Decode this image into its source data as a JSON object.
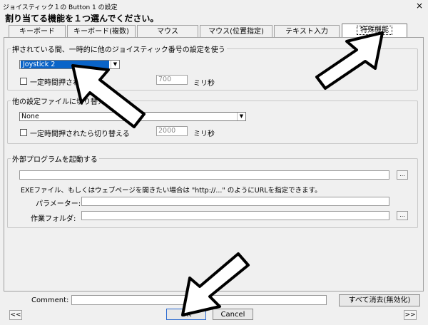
{
  "window": {
    "title": "ジョイスティック１の Button 1 の設定",
    "close": "×"
  },
  "heading": "割り当てる機能を１つ選んでください。",
  "tabs": [
    {
      "label": "キーボード"
    },
    {
      "label": "キーボード(複数)"
    },
    {
      "label": "マウス"
    },
    {
      "label": "マウス(位置指定)"
    },
    {
      "label": "テキスト入力"
    },
    {
      "label": "特殊機能",
      "active": true
    }
  ],
  "group1": {
    "legend": "押されている間、一時的に他のジョイスティック番号の設定を使う",
    "combo_value": "Joystick 2",
    "check_label": "一定時間押されたら",
    "ms_value": "700",
    "ms_unit": "ミリ秒"
  },
  "group2": {
    "legend": "他の設定ファイルに切り替え",
    "combo_value": "None",
    "check_label": "一定時間押されたら切り替える",
    "ms_value": "2000",
    "ms_unit": "ミリ秒"
  },
  "group3": {
    "legend": "外部プログラムを起動する",
    "path_value": "",
    "browse": "...",
    "hint": "EXEファイル、もしくはウェブページを開きたい場合は \"http://...\" のようにURLを指定できます。",
    "param_label": "パラメーター:",
    "folder_label": "作業フォルダ:",
    "folder_browse": "..."
  },
  "footer": {
    "comment_label": "Comment:",
    "comment_value": "",
    "clear_all": "すべて消去(無効化)",
    "prev": "<<",
    "next": ">>",
    "ok": "OK",
    "cancel": "Cancel"
  }
}
